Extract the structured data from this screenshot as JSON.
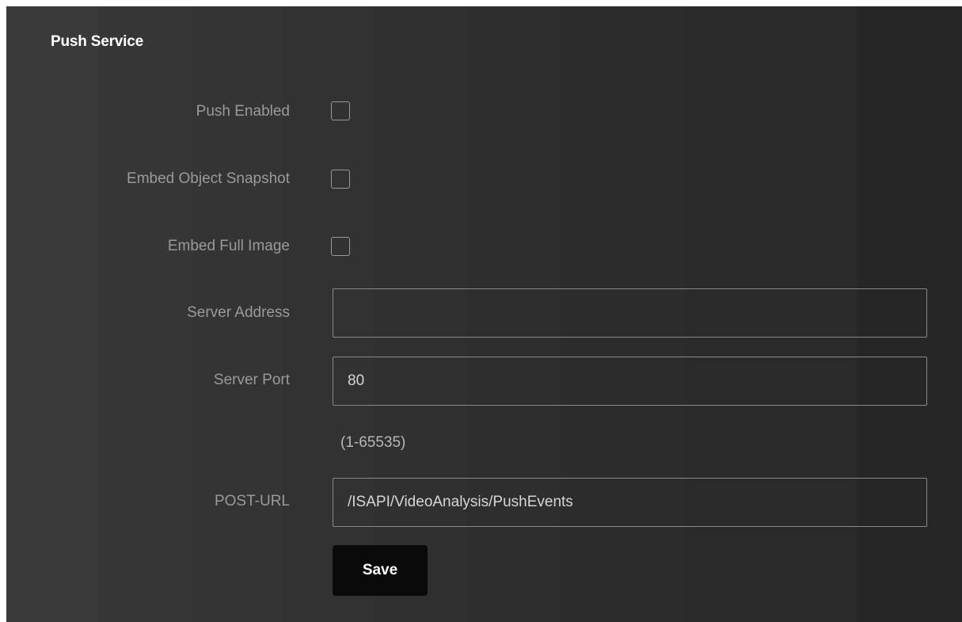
{
  "section": {
    "title": "Push Service"
  },
  "fields": {
    "push_enabled": {
      "label": "Push Enabled",
      "checked": false
    },
    "embed_object_snapshot": {
      "label": "Embed Object Snapshot",
      "checked": false
    },
    "embed_full_image": {
      "label": "Embed Full Image",
      "checked": false
    },
    "server_address": {
      "label": "Server Address",
      "value": ""
    },
    "server_port": {
      "label": "Server Port",
      "value": "80",
      "hint": "(1-65535)"
    },
    "post_url": {
      "label": "POST-URL",
      "value": "/ISAPI/VideoAnalysis/PushEvents"
    }
  },
  "actions": {
    "save_label": "Save"
  },
  "colors": {
    "background": "#2c2c2c",
    "label_text": "#9a9a9a",
    "save_button_bg": "#0a0a0a"
  }
}
